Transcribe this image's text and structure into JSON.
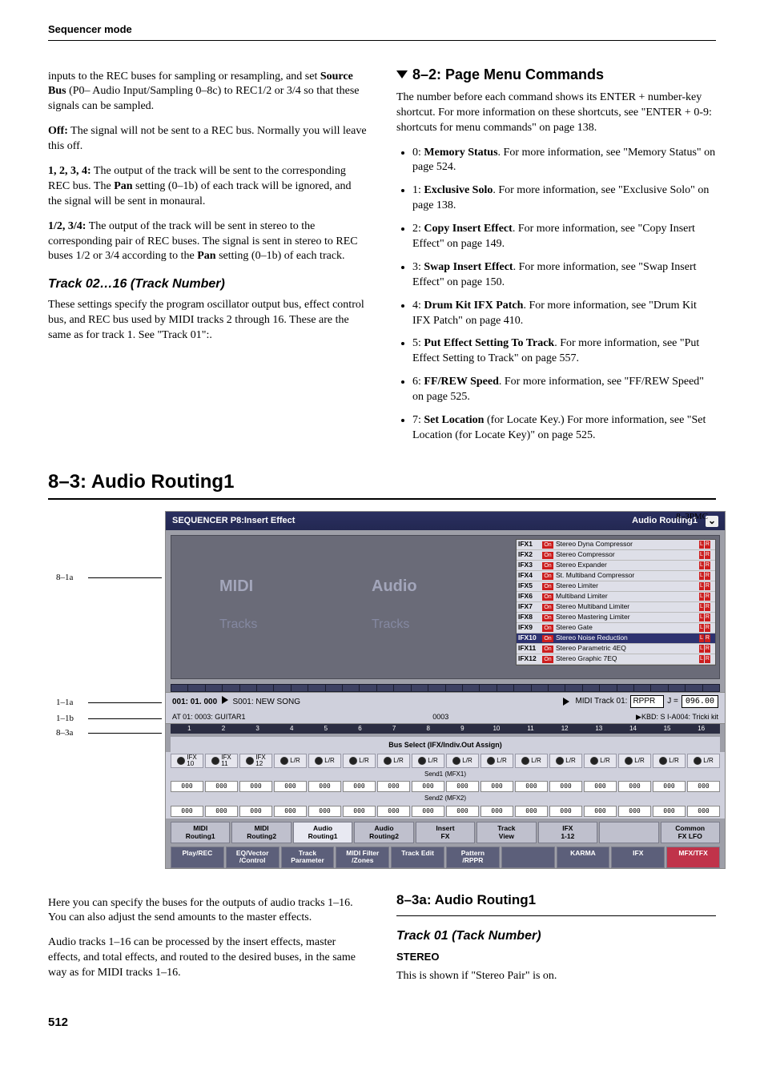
{
  "header": {
    "running": "Sequencer mode"
  },
  "left": {
    "p1a": "inputs to the REC buses for sampling or resampling, and set ",
    "p1b": "Source Bus",
    "p1c": " (P0– Audio Input/Sampling 0–8c) to REC1/2 or 3/4 so that these signals can be sampled.",
    "off_b": "Off:",
    "off_t": " The signal will not be sent to a REC bus. Normally you will leave this off.",
    "n1234_b": "1, 2, 3, 4:",
    "n1234_t1": " The output of the track will be sent to the corresponding REC bus. The ",
    "n1234_pan": "Pan",
    "n1234_t2": " setting (0–1b) of each track will be ignored, and the signal will be sent in monaural.",
    "n12_b": "1/2, 3/4:",
    "n12_t1": " The output of the track will be sent in stereo to the corresponding pair of REC buses. The signal is sent in stereo to REC buses 1/2 or 3/4 according to the ",
    "n12_pan": "Pan",
    "n12_t2": " setting (0–1b) of each track.",
    "trk_head": "Track 02…16 (Track Number)",
    "trk_body": "These settings specify the program oscillator output bus, effect control bus, and REC bus used by MIDI tracks 2 through 16. These are the same as for track 1. See \"Track 01\":."
  },
  "right": {
    "h": "8–2: Page Menu Commands",
    "intro": "The number before each command shows its ENTER + number-key shortcut. For more information on these shortcuts, see \"ENTER + 0-9: shortcuts for menu commands\" on page 138.",
    "items": [
      {
        "pre": "0: ",
        "b": "Memory Status",
        "post": ". For more information, see \"Memory Status\" on page 524."
      },
      {
        "pre": "1: ",
        "b": "Exclusive Solo",
        "post": ". For more information, see \"Exclusive Solo\" on page 138."
      },
      {
        "pre": "2: ",
        "b": "Copy Insert Effect",
        "post": ". For more information, see \"Copy Insert Effect\" on page 149."
      },
      {
        "pre": "3: ",
        "b": "Swap Insert Effect",
        "post": ". For more information, see \"Swap Insert Effect\" on page 150."
      },
      {
        "pre": "4: ",
        "b": "Drum Kit IFX Patch",
        "post": ". For more information, see \"Drum Kit IFX Patch\" on page 410."
      },
      {
        "pre": "5: ",
        "b": "Put Effect Setting To Track",
        "post": ". For more information, see \"Put Effect Setting to Track\" on page 557."
      },
      {
        "pre": "6: ",
        "b": "FF/REW Speed",
        "post": ". For more information, see \"FF/REW Speed\" on page 525."
      },
      {
        "pre": "7: ",
        "b": "Set Location",
        "post_a": " (for Locate Key.) For more information, see \"Set Location (for Locate Key)\" on page 525."
      }
    ]
  },
  "big": "8–3: Audio Routing1",
  "labels": {
    "pmc": "8–3PMC",
    "l81a": "8–1a",
    "l11a": "1–1a",
    "l11b": "1–1b",
    "l83a": "8–3a"
  },
  "shot": {
    "title_l": "SEQUENCER P8:Insert Effect",
    "title_r": "Audio Routing1",
    "dd": "⌄",
    "graph": {
      "midi": "MIDI",
      "audio": "Audio",
      "tracks1": "Tracks",
      "tracks2": "Tracks"
    },
    "ifx": [
      {
        "lab": "IFX1",
        "nm": "Stereo Dyna Compressor"
      },
      {
        "lab": "IFX2",
        "nm": "Stereo Compressor"
      },
      {
        "lab": "IFX3",
        "nm": "Stereo Expander"
      },
      {
        "lab": "IFX4",
        "nm": "St. Multiband Compressor"
      },
      {
        "lab": "IFX5",
        "nm": "Stereo Limiter"
      },
      {
        "lab": "IFX6",
        "nm": "Multiband Limiter"
      },
      {
        "lab": "IFX7",
        "nm": "Stereo Multiband Limiter"
      },
      {
        "lab": "IFX8",
        "nm": "Stereo Mastering Limiter"
      },
      {
        "lab": "IFX9",
        "nm": "Stereo Gate"
      },
      {
        "lab": "IFX10",
        "nm": "Stereo Noise Reduction",
        "sel": true
      },
      {
        "lab": "IFX11",
        "nm": "Stereo Parametric 4EQ"
      },
      {
        "lab": "IFX12",
        "nm": "Stereo Graphic 7EQ"
      }
    ],
    "info": {
      "song": "001: 01. 000",
      "songname": "S001: NEW SONG",
      "midi": "MIDI Track 01:",
      "rppr": "RPPR",
      "j": "J =",
      "jval": "096.00"
    },
    "sub": {
      "left": "AT 01: 0003: GUITAR1",
      "mid": "0003",
      "right": "▶KBD: S I-A004: Tricki kit"
    },
    "nums": [
      "1",
      "2",
      "3",
      "4",
      "5",
      "6",
      "7",
      "8",
      "9",
      "10",
      "11",
      "12",
      "13",
      "14",
      "15",
      "16"
    ],
    "bussel": "Bus Select (IFX/Indiv.Out Assign)",
    "bus_first": [
      "IFX\n10",
      "IFX\n11",
      "IFX\n12"
    ],
    "bus_lr": "L/R",
    "send1": "Send1 (MFX1)",
    "send2": "Send2 (MFX2)",
    "val": "000",
    "tabs1": [
      "MIDI\nRouting1",
      "MIDI\nRouting2",
      "Audio\nRouting1",
      "Audio\nRouting2",
      "Insert\nFX",
      "Track\nView",
      "IFX\n1-12",
      "",
      "Common\nFX LFO"
    ],
    "tabs2": [
      "Play/REC",
      "EQ/Vector\n/Control",
      "Track\nParameter",
      "MIDI Filter\n/Zones",
      "Track Edit",
      "Pattern\n/RPPR",
      "",
      "KARMA",
      "IFX",
      "MFX/TFX"
    ]
  },
  "lower": {
    "p1": "Here you can specify the buses for the outputs of audio tracks 1–16. You can also adjust the send amounts to the master effects.",
    "p2": "Audio tracks 1–16 can be processed by the insert effects, master effects, and total effects, and routed to the desired buses, in the same way as for MIDI tracks 1–16.",
    "r_h": "8–3a: Audio Routing1",
    "r_it": "Track 01 (Tack Number)",
    "r_st": "STEREO",
    "r_body": "This is shown if \"Stereo Pair\" is on."
  },
  "page": "512"
}
